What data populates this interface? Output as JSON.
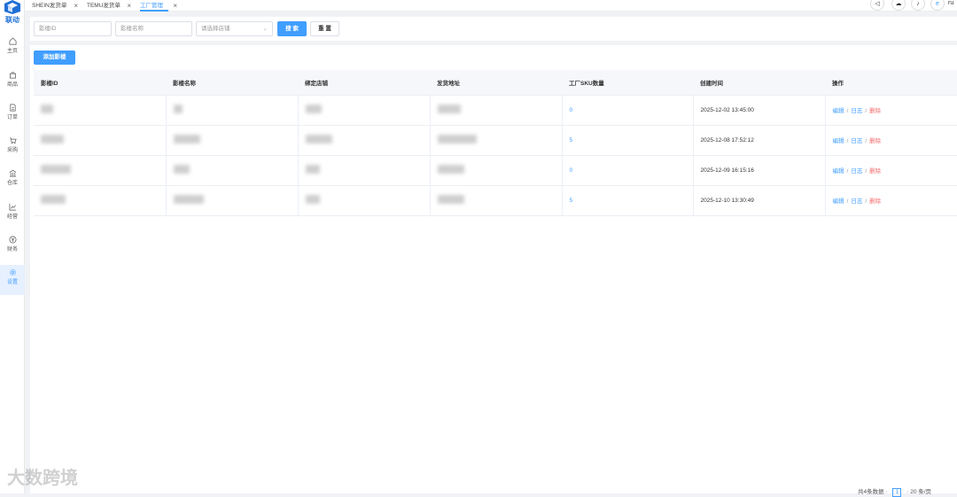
{
  "sidebar": {
    "brand": "联动",
    "items": [
      {
        "label": "主页",
        "icon": "home-icon"
      },
      {
        "label": "商品",
        "icon": "bag-icon"
      },
      {
        "label": "订单",
        "icon": "document-icon"
      },
      {
        "label": "采购",
        "icon": "cart-icon"
      },
      {
        "label": "仓库",
        "icon": "warehouse-icon"
      },
      {
        "label": "经营",
        "icon": "chart-icon"
      },
      {
        "label": "财务",
        "icon": "yen-icon"
      },
      {
        "label": "设置",
        "icon": "gear-icon"
      }
    ],
    "active_index": 7
  },
  "tabs": [
    {
      "label": "SHEIN发货单"
    },
    {
      "label": "TEMU发货单"
    },
    {
      "label": "工厂管理"
    }
  ],
  "header_right": {
    "user_initial": "e",
    "user_text": "ru"
  },
  "search": {
    "id_placeholder": "影楼ID",
    "name_placeholder": "影楼名称",
    "store_placeholder": "请选择店铺",
    "search_label": "搜 索",
    "reset_label": "重 置"
  },
  "add_button_label": "添加影楼",
  "table": {
    "columns": [
      "影楼ID",
      "影楼名称",
      "绑定店铺",
      "发货地址",
      "工厂SKU数量",
      "创建时间",
      "操作"
    ],
    "rows": [
      {
        "sku_count": "0",
        "created": "2025-12-02 13:45:00"
      },
      {
        "sku_count": "5",
        "created": "2025-12-08 17:52:12"
      },
      {
        "sku_count": "0",
        "created": "2025-12-09 16:15:16"
      },
      {
        "sku_count": "5",
        "created": "2025-12-10 13:30:49"
      }
    ],
    "actions": {
      "edit": "编辑",
      "log": "日志",
      "delete": "删除",
      "separator": "/"
    }
  },
  "pager": {
    "total_text": "共4条数据",
    "current_page": "1",
    "page_size": "20 条/页"
  },
  "watermark": "大数跨境",
  "colors": {
    "primary": "#409eff",
    "danger": "#f56c6c",
    "brand": "#1f6fd6"
  }
}
